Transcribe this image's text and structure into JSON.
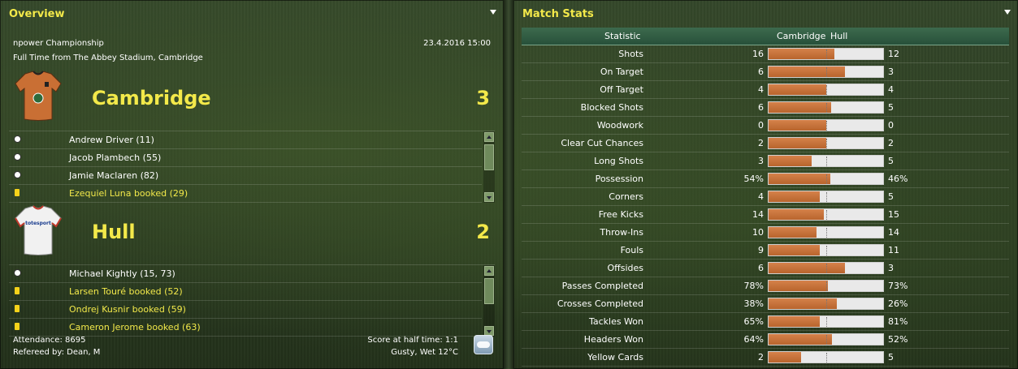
{
  "overview": {
    "title": "Overview",
    "competition": "npower Championship",
    "datetime": "23.4.2016 15:00",
    "result_line": "Full Time from The Abbey Stadium, Cambridge",
    "home": {
      "name": "Cambridge",
      "score": "3",
      "kit_text": "",
      "events": [
        {
          "type": "goal",
          "text": "Andrew Driver (11)"
        },
        {
          "type": "goal",
          "text": "Jacob Plambech (55)"
        },
        {
          "type": "goal",
          "text": "Jamie Maclaren (82)"
        },
        {
          "type": "booking",
          "text": "Ezequiel Luna booked (29)"
        }
      ]
    },
    "away": {
      "name": "Hull",
      "score": "2",
      "kit_text": "totesport",
      "events": [
        {
          "type": "goal",
          "text": "Michael Kightly (15, 73)"
        },
        {
          "type": "booking",
          "text": "Larsen Touré booked (52)"
        },
        {
          "type": "booking",
          "text": "Ondrej Kusnir booked (59)"
        },
        {
          "type": "booking",
          "text": "Cameron Jerome booked (63)"
        }
      ]
    },
    "attendance": "Attendance: 8695",
    "referee": "Refereed by: Dean, M",
    "half_time": "Score at half time: 1:1",
    "weather": "Gusty, Wet 12°C",
    "weather_icon": "cloud-rain-icon"
  },
  "match_stats": {
    "title": "Match Stats",
    "header": {
      "statistic": "Statistic",
      "home": "Cambridge",
      "away": "Hull"
    },
    "colors": {
      "home_bar": "#c4703a",
      "away_bar": "#e9e9e9",
      "title": "#f3e94a"
    },
    "rows": [
      {
        "label": "Shots",
        "home": "16",
        "away": "12",
        "home_share": 0.571
      },
      {
        "label": "On Target",
        "home": "6",
        "away": "3",
        "home_share": 0.667
      },
      {
        "label": "Off Target",
        "home": "4",
        "away": "4",
        "home_share": 0.5
      },
      {
        "label": "Blocked Shots",
        "home": "6",
        "away": "5",
        "home_share": 0.545
      },
      {
        "label": "Woodwork",
        "home": "0",
        "away": "0",
        "home_share": 0.5
      },
      {
        "label": "Clear Cut Chances",
        "home": "2",
        "away": "2",
        "home_share": 0.5
      },
      {
        "label": "Long Shots",
        "home": "3",
        "away": "5",
        "home_share": 0.375
      },
      {
        "label": "Possession",
        "home": "54%",
        "away": "46%",
        "home_share": 0.54
      },
      {
        "label": "Corners",
        "home": "4",
        "away": "5",
        "home_share": 0.444
      },
      {
        "label": "Free Kicks",
        "home": "14",
        "away": "15",
        "home_share": 0.483
      },
      {
        "label": "Throw-Ins",
        "home": "10",
        "away": "14",
        "home_share": 0.417
      },
      {
        "label": "Fouls",
        "home": "9",
        "away": "11",
        "home_share": 0.45
      },
      {
        "label": "Offsides",
        "home": "6",
        "away": "3",
        "home_share": 0.667
      },
      {
        "label": "Passes Completed",
        "home": "78%",
        "away": "73%",
        "home_share": 0.517
      },
      {
        "label": "Crosses Completed",
        "home": "38%",
        "away": "26%",
        "home_share": 0.594
      },
      {
        "label": "Tackles Won",
        "home": "65%",
        "away": "81%",
        "home_share": 0.445
      },
      {
        "label": "Headers Won",
        "home": "64%",
        "away": "52%",
        "home_share": 0.552
      },
      {
        "label": "Yellow Cards",
        "home": "2",
        "away": "5",
        "home_share": 0.286
      }
    ]
  }
}
